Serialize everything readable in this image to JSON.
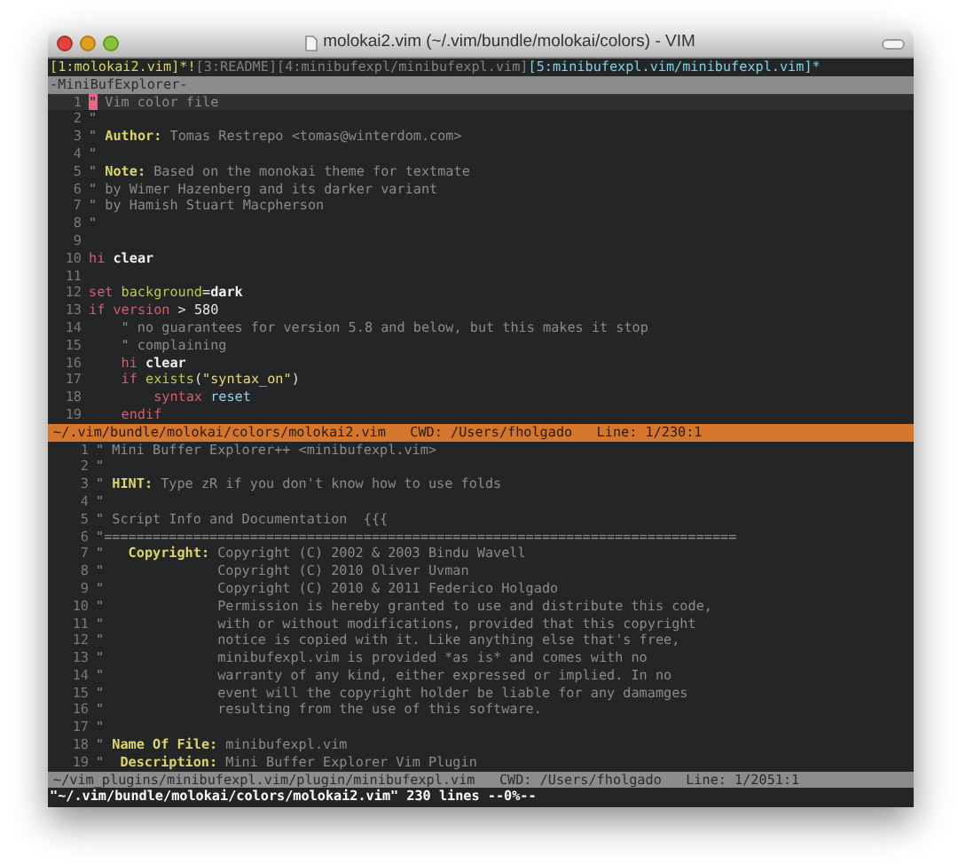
{
  "window": {
    "title": "molokai2.vim (~/.vim/bundle/molokai/colors) - VIM"
  },
  "buffers": [
    {
      "label": "[1:molokai2.vim]*!",
      "kind": "current"
    },
    {
      "label": "[3:README]",
      "kind": "hidden"
    },
    {
      "label": "[4:minibufexpl/minibufexpl.vim]",
      "kind": "hidden"
    },
    {
      "label": "[5:minibufexpl.vim/minibufexpl.vim]*",
      "kind": "visible"
    }
  ],
  "explorer_status": "-MiniBufExplorer-",
  "panes": [
    {
      "active": true,
      "lines": [
        {
          "number": "1",
          "cursorline": true,
          "segments": [
            {
              "text": "\"",
              "kind": "cursor"
            },
            {
              "text": " Vim color file",
              "kind": "comment"
            }
          ]
        },
        {
          "number": "2",
          "segments": [
            {
              "text": "\"",
              "kind": "comment"
            }
          ]
        },
        {
          "number": "3",
          "segments": [
            {
              "text": "\" ",
              "kind": "comment"
            },
            {
              "text": "Author:",
              "kind": "label"
            },
            {
              "text": " Tomas Restrepo <tomas@winterdom.com>",
              "kind": "comment"
            }
          ]
        },
        {
          "number": "4",
          "segments": [
            {
              "text": "\"",
              "kind": "comment"
            }
          ]
        },
        {
          "number": "5",
          "segments": [
            {
              "text": "\" ",
              "kind": "comment"
            },
            {
              "text": "Note:",
              "kind": "label"
            },
            {
              "text": " Based on the monokai theme for textmate",
              "kind": "comment"
            }
          ]
        },
        {
          "number": "6",
          "segments": [
            {
              "text": "\" by Wimer Hazenberg and its darker variant",
              "kind": "comment"
            }
          ]
        },
        {
          "number": "7",
          "segments": [
            {
              "text": "\" by Hamish Stuart Macpherson",
              "kind": "comment"
            }
          ]
        },
        {
          "number": "8",
          "segments": [
            {
              "text": "\"",
              "kind": "comment"
            }
          ]
        },
        {
          "number": "9"
        },
        {
          "number": "10",
          "segments": [
            {
              "text": "hi",
              "kind": "keyword"
            },
            {
              "text": " clear",
              "kind": "bold"
            }
          ]
        },
        {
          "number": "11"
        },
        {
          "number": "12",
          "segments": [
            {
              "text": "set",
              "kind": "keyword"
            },
            {
              "text": " background",
              "kind": "option"
            },
            {
              "text": "=",
              "kind": "plain"
            },
            {
              "text": "dark",
              "kind": "bold"
            }
          ]
        },
        {
          "number": "13",
          "segments": [
            {
              "text": "if",
              "kind": "keyword"
            },
            {
              "text": " version",
              "kind": "keyword"
            },
            {
              "text": " > ",
              "kind": "plain"
            },
            {
              "text": "580",
              "kind": "number"
            }
          ]
        },
        {
          "number": "14",
          "segments": [
            {
              "text": "    \" no guarantees for version 5.8 and below, but this makes it stop",
              "kind": "comment"
            }
          ]
        },
        {
          "number": "15",
          "segments": [
            {
              "text": "    \" complaining",
              "kind": "comment"
            }
          ]
        },
        {
          "number": "16",
          "segments": [
            {
              "text": "    hi",
              "kind": "keyword"
            },
            {
              "text": " clear",
              "kind": "bold"
            }
          ]
        },
        {
          "number": "17",
          "segments": [
            {
              "text": "    if",
              "kind": "keyword"
            },
            {
              "text": " exists",
              "kind": "option"
            },
            {
              "text": "(",
              "kind": "plain"
            },
            {
              "text": "\"syntax_on\"",
              "kind": "string"
            },
            {
              "text": ")",
              "kind": "plain"
            }
          ]
        },
        {
          "number": "18",
          "segments": [
            {
              "text": "        syntax",
              "kind": "keyword"
            },
            {
              "text": " reset",
              "kind": "type"
            }
          ]
        },
        {
          "number": "19",
          "segments": [
            {
              "text": "    endif",
              "kind": "keyword"
            }
          ]
        }
      ],
      "status": "~/.vim/bundle/molokai/colors/molokai2.vim   CWD: /Users/fholgado   Line: 1/230:1"
    },
    {
      "active": false,
      "lines": [
        {
          "number": "1",
          "segments": [
            {
              "text": "\" Mini Buffer Explorer++ <minibufexpl.vim>",
              "kind": "comment"
            }
          ]
        },
        {
          "number": "2",
          "segments": [
            {
              "text": "\"",
              "kind": "comment"
            }
          ]
        },
        {
          "number": "3",
          "segments": [
            {
              "text": "\" ",
              "kind": "comment"
            },
            {
              "text": "HINT:",
              "kind": "label"
            },
            {
              "text": " Type zR if you don't know how to use folds",
              "kind": "comment"
            }
          ]
        },
        {
          "number": "4",
          "segments": [
            {
              "text": "\"",
              "kind": "comment"
            }
          ]
        },
        {
          "number": "5",
          "segments": [
            {
              "text": "\" Script Info and Documentation  {{{",
              "kind": "comment"
            }
          ]
        },
        {
          "number": "6",
          "segments": [
            {
              "text": "\"==============================================================================",
              "kind": "comment"
            }
          ]
        },
        {
          "number": "7",
          "segments": [
            {
              "text": "\"   ",
              "kind": "comment"
            },
            {
              "text": "Copyright:",
              "kind": "label"
            },
            {
              "text": " Copyright (C) 2002 & 2003 Bindu Wavell",
              "kind": "comment"
            }
          ]
        },
        {
          "number": "8",
          "segments": [
            {
              "text": "\"              Copyright (C) 2010 Oliver Uvman",
              "kind": "comment"
            }
          ]
        },
        {
          "number": "9",
          "segments": [
            {
              "text": "\"              Copyright (C) 2010 & 2011 Federico Holgado",
              "kind": "comment"
            }
          ]
        },
        {
          "number": "10",
          "segments": [
            {
              "text": "\"              Permission is hereby granted to use and distribute this code,",
              "kind": "comment"
            }
          ]
        },
        {
          "number": "11",
          "segments": [
            {
              "text": "\"              with or without modifications, provided that this copyright",
              "kind": "comment"
            }
          ]
        },
        {
          "number": "12",
          "segments": [
            {
              "text": "\"              notice is copied with it. Like anything else that's free,",
              "kind": "comment"
            }
          ]
        },
        {
          "number": "13",
          "segments": [
            {
              "text": "\"              minibufexpl.vim is provided *as is* and comes with no",
              "kind": "comment"
            }
          ]
        },
        {
          "number": "14",
          "segments": [
            {
              "text": "\"              warranty of any kind, either expressed or implied. In no",
              "kind": "comment"
            }
          ]
        },
        {
          "number": "15",
          "segments": [
            {
              "text": "\"              event will the copyright holder be liable for any damamges",
              "kind": "comment"
            }
          ]
        },
        {
          "number": "16",
          "segments": [
            {
              "text": "\"              resulting from the use of this software.",
              "kind": "comment"
            }
          ]
        },
        {
          "number": "17",
          "segments": [
            {
              "text": "\"",
              "kind": "comment"
            }
          ]
        },
        {
          "number": "18",
          "segments": [
            {
              "text": "\" ",
              "kind": "comment"
            },
            {
              "text": "Name Of File:",
              "kind": "label"
            },
            {
              "text": " minibufexpl.vim",
              "kind": "comment"
            }
          ]
        },
        {
          "number": "19",
          "segments": [
            {
              "text": "\"  ",
              "kind": "comment"
            },
            {
              "text": "Description:",
              "kind": "label"
            },
            {
              "text": " Mini Buffer Explorer Vim Plugin",
              "kind": "comment"
            }
          ]
        }
      ],
      "status": "~/vim_plugins/minibufexpl.vim/plugin/minibufexpl.vim   CWD: /Users/fholgado   Line: 1/2051:1"
    }
  ],
  "command_line": "\"~/.vim/bundle/molokai/colors/molokai2.vim\" 230 lines --0%--"
}
